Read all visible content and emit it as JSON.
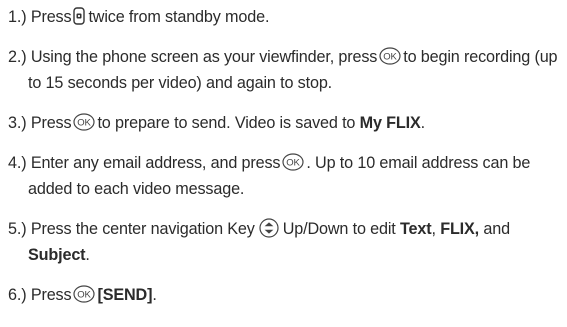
{
  "steps": [
    {
      "num": "1.)",
      "t1": "Press",
      "t2": "twice from standby mode."
    },
    {
      "num": "2.)",
      "t1": "Using the phone screen as your viewfinder, press",
      "t2": "to begin recording (up to 15 seconds per video) and again to stop."
    },
    {
      "num": "3.)",
      "t1": "Press",
      "t2": "to prepare to send. Video is saved to",
      "b1": "My FLIX",
      "t3": "."
    },
    {
      "num": "4.)",
      "t1": "Enter any email address, and press",
      "t2": ". Up to 10 email address can be added to each video message."
    },
    {
      "num": "5.)",
      "t1": "Press the center navigation Key",
      "t2": "Up/Down to edit",
      "b1": "Text",
      "t3": ",",
      "b2": "FLIX,",
      "t4": "and",
      "b3": "Subject",
      "t5": "."
    },
    {
      "num": "6.)",
      "t1": "Press",
      "b1": "[SEND]",
      "t2": "."
    }
  ],
  "icons": {
    "ok_label": "OK",
    "camera": "camera-key-icon",
    "ok": "ok-key-icon",
    "nav": "navigation-key-icon"
  }
}
